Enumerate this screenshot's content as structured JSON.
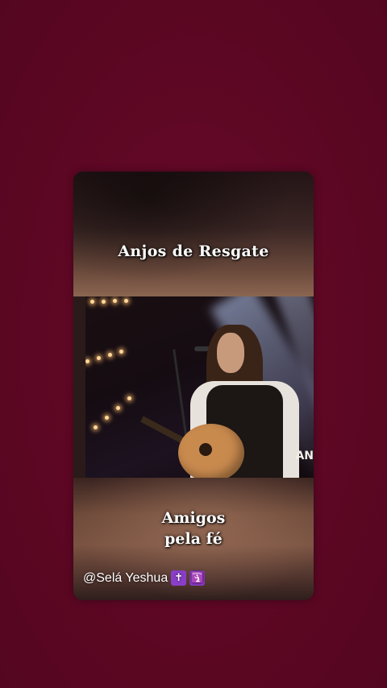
{
  "post": {
    "title": "Anjos de Resgate",
    "subtitle_line1": "Amigos",
    "subtitle_line2": "pela fé",
    "handle": "@Selá Yeshua",
    "emoji1": "✝",
    "emoji2": "🛐",
    "video_watermark": "AN"
  },
  "colors": {
    "background": "#5e0825",
    "emoji_tile": "#8a3ec8"
  }
}
